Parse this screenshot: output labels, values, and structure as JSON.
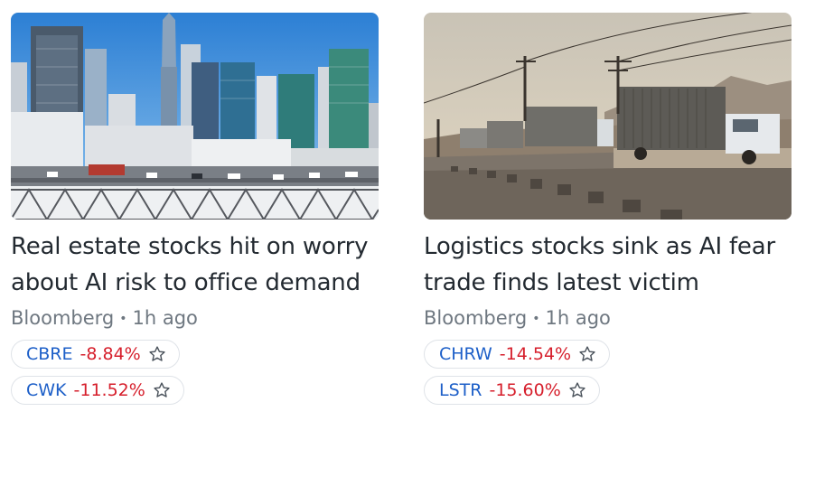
{
  "articles": [
    {
      "image_desc": "city skyline with bridge traffic",
      "headline": "Real estate stocks hit on worry about AI risk to office demand",
      "source": "Bloomberg",
      "time": "1h ago",
      "tickers": [
        {
          "symbol": "CBRE",
          "change": "-8.84%"
        },
        {
          "symbol": "CWK",
          "change": "-11.52%"
        }
      ]
    },
    {
      "image_desc": "trucks on a highway at dusk",
      "headline": "Logistics stocks sink as AI fear trade finds latest victim",
      "source": "Bloomberg",
      "time": "1h ago",
      "tickers": [
        {
          "symbol": "CHRW",
          "change": "-14.54%"
        },
        {
          "symbol": "LSTR",
          "change": "-15.60%"
        }
      ]
    }
  ],
  "separator": "•",
  "icons": {
    "watchlist": "star-outline-icon"
  },
  "colors": {
    "ticker": "#1d5fc8",
    "negative": "#d61f2c",
    "text": "#232a31",
    "meta": "#6e7780"
  }
}
